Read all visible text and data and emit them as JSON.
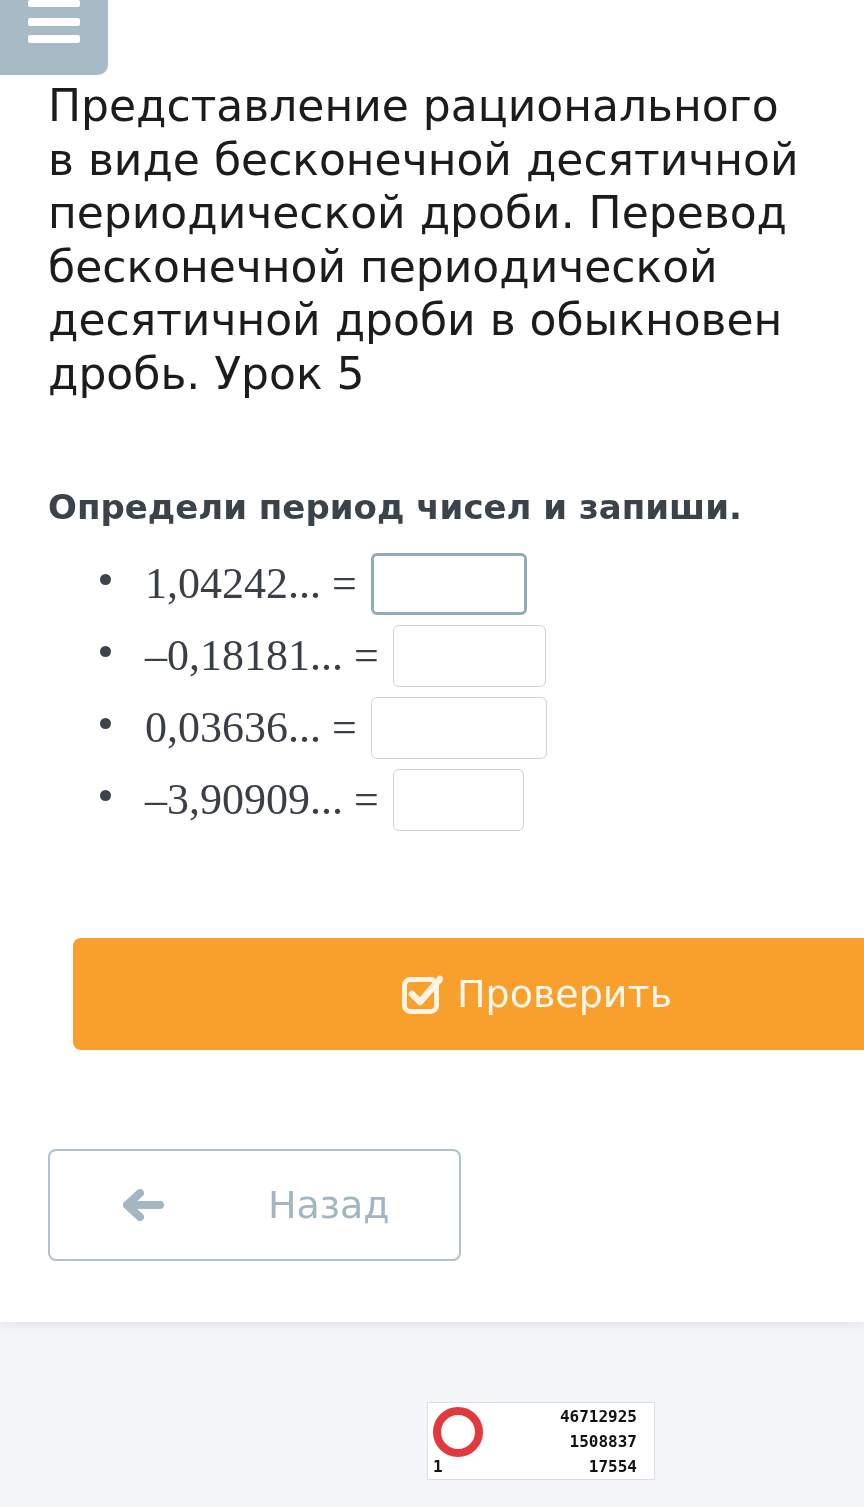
{
  "title_lines": [
    "Представление рационального",
    "в виде бесконечной десятичной",
    "периодической дроби. Перевод",
    "бесконечной периодической",
    "десятичной дроби в обыкновен",
    "дробь. Урок 5"
  ],
  "task": {
    "prompt": "Определи период чисел и запиши.",
    "items": [
      {
        "expression": "1,04242... =",
        "focused": true
      },
      {
        "expression": "–0,18181... =",
        "focused": false
      },
      {
        "expression": "0,03636... =",
        "focused": false
      },
      {
        "expression": "–3,90909... =",
        "focused": false
      }
    ]
  },
  "check_button": {
    "label": "Проверить"
  },
  "back_button": {
    "label": "Назад"
  },
  "counter": {
    "mark": "1",
    "lines": [
      "46712925",
      "1508837",
      "17554"
    ]
  }
}
